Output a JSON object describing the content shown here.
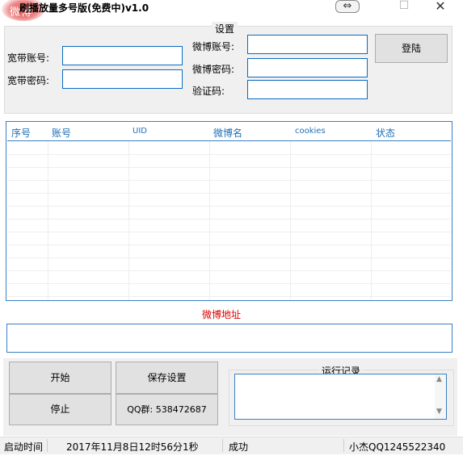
{
  "window": {
    "logo_text": "微博",
    "title": "刷播放量多号版(免费中)v1.0",
    "icons": {
      "restore": "⇔",
      "maximize": "☐",
      "close": "✕"
    }
  },
  "settings": {
    "legend": "设置",
    "broadband_account_label": "宽带账号:",
    "broadband_account_value": "",
    "broadband_password_label": "宽带密码:",
    "broadband_password_value": "",
    "weibo_account_label": "微博账号:",
    "weibo_account_value": "",
    "weibo_password_label": "微博密码:",
    "weibo_password_value": "",
    "captcha_label": "验证码:",
    "captcha_value": "",
    "login_button": "登陆"
  },
  "table": {
    "columns": [
      "序号",
      "账号",
      "UID",
      "微博名",
      "cookies",
      "状态"
    ],
    "rows": []
  },
  "weibo_address": {
    "label": "微博地址",
    "value": ""
  },
  "controls": {
    "start": "开始",
    "save_settings": "保存设置",
    "stop": "停止",
    "qq_group": "QQ群: 538472687"
  },
  "log": {
    "legend": "运行记录",
    "content": ""
  },
  "status_bar": {
    "start_time_label": "启动时间",
    "start_time_value": "2017年11月8日12时56分1秒",
    "status": "成功",
    "author": "小杰QQ1245522340"
  }
}
